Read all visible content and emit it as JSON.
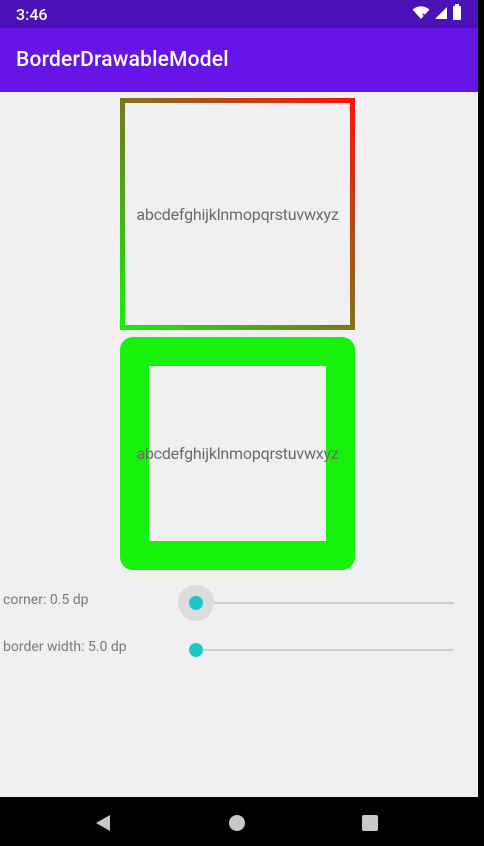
{
  "status_bar": {
    "time": "3:46"
  },
  "app_bar": {
    "title": "BorderDrawableModel"
  },
  "boxes": {
    "gradient_border_text": "abcdefghijklnmopqrstuvwxyz",
    "solid_border_text": "abcdefghijklnmopqrstuvwxyz"
  },
  "sliders": {
    "corner": {
      "label": "corner: 0.5 dp",
      "value_fraction": 0.0
    },
    "border_width": {
      "label": "border width: 5.0 dp",
      "value_fraction": 0.0
    }
  },
  "colors": {
    "status_bar": "#4a12b6",
    "app_bar": "#6615e6",
    "solid_border": "#16f20c",
    "slider_thumb": "#1ec8c8"
  },
  "icons": {
    "wifi": "wifi-icon",
    "signal": "signal-icon",
    "battery": "battery-icon",
    "back": "back-icon",
    "home": "home-icon",
    "recents": "recents-icon"
  }
}
